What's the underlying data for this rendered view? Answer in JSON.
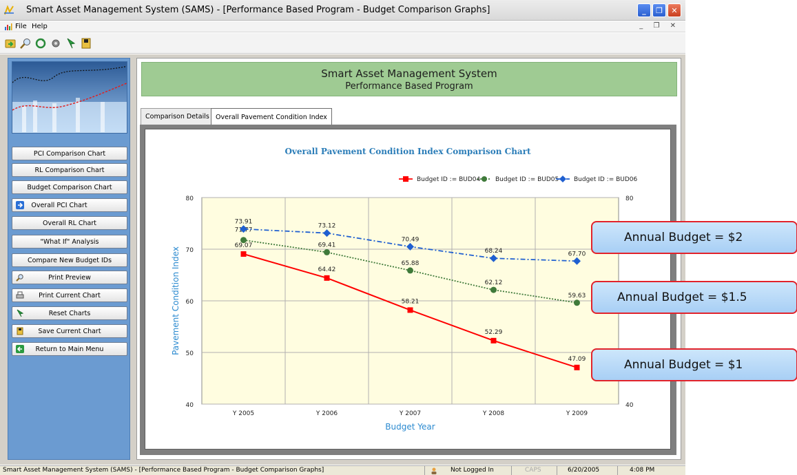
{
  "window": {
    "title": "Smart Asset Management System (SAMS) - [Performance Based Program - Budget Comparison Graphs]",
    "minimize": "_",
    "restore": "❐",
    "close": "✕"
  },
  "menu": {
    "items": [
      "File",
      "Help"
    ],
    "mdi_controls": "_ ❐ ✕"
  },
  "toolbar": {
    "icons": [
      "open-icon",
      "search-icon",
      "refresh-icon",
      "settings-icon",
      "reset-icon",
      "save-icon"
    ]
  },
  "sidebar": {
    "buttons": [
      {
        "label": "PCI Comparison Chart",
        "icon": ""
      },
      {
        "label": "RL Comparison Chart",
        "icon": ""
      },
      {
        "label": "Budget Comparison Chart",
        "icon": ""
      },
      {
        "label": "Overall PCI Chart",
        "icon": "arrow-right-icon"
      },
      {
        "label": "Overall RL Chart",
        "icon": ""
      },
      {
        "label": "\"What If\" Analysis",
        "icon": ""
      },
      {
        "label": "Compare New Budget IDs",
        "icon": ""
      },
      {
        "label": "Print Preview",
        "icon": "print-preview-icon"
      },
      {
        "label": "Print Current Chart",
        "icon": "printer-icon"
      },
      {
        "label": "Reset Charts",
        "icon": "reset-icon"
      },
      {
        "label": "Save Current Chart",
        "icon": "save-icon"
      },
      {
        "label": "Return to Main Menu",
        "icon": "return-icon"
      }
    ]
  },
  "header": {
    "title": "Smart Asset Management System",
    "subtitle": "Performance Based Program"
  },
  "tabs": [
    {
      "label": "Comparison Details",
      "active": false
    },
    {
      "label": "Overall Pavement Condition Index",
      "active": true
    }
  ],
  "chart_data": {
    "type": "line",
    "title": "Overall Pavement Condition Index Comparison Chart",
    "xlabel": "Budget Year",
    "ylabel": "Pavement Condition Index",
    "categories": [
      "Y 2005",
      "Y 2006",
      "Y 2007",
      "Y 2008",
      "Y 2009"
    ],
    "ylim": [
      40,
      80
    ],
    "yticks": [
      40,
      50,
      60,
      70,
      80
    ],
    "grid": true,
    "legend_position": "top-right",
    "series": [
      {
        "name": "Budget ID := BUD04",
        "values": [
          69.07,
          64.42,
          58.21,
          52.29,
          47.09
        ],
        "color": "#ff0000",
        "marker": "square",
        "dash": "solid"
      },
      {
        "name": "Budget ID := BUD05",
        "values": [
          71.77,
          69.41,
          65.88,
          62.12,
          59.63
        ],
        "color": "#3f7a3a",
        "marker": "circle",
        "dash": "dotted"
      },
      {
        "name": "Budget ID := BUD06",
        "values": [
          73.91,
          73.12,
          70.49,
          68.24,
          67.7
        ],
        "color": "#1f5fd0",
        "marker": "diamond",
        "dash": "dashdot"
      }
    ]
  },
  "callouts": [
    "Annual Budget = $2",
    "Annual Budget = $1.5",
    "Annual Budget = $1"
  ],
  "statusbar": {
    "text": "Smart Asset Management System (SAMS) - [Performance Based Program - Budget Comparison Graphs]",
    "login": "Not Logged In",
    "caps": "CAPS",
    "date": "6/20/2005",
    "time": "4:08 PM"
  }
}
